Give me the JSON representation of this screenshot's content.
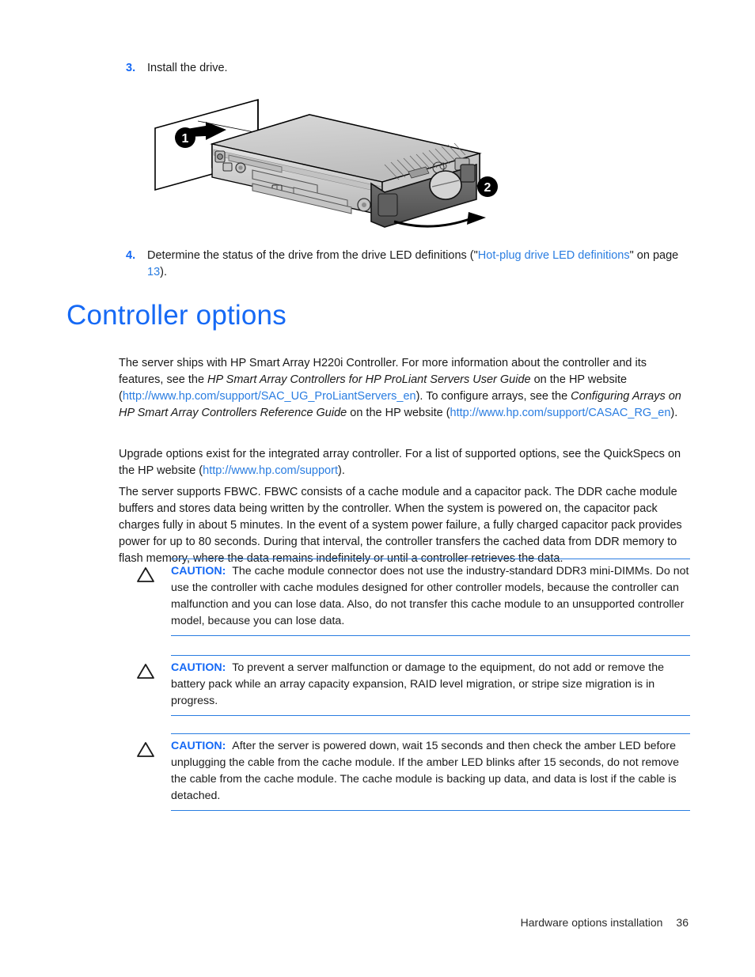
{
  "document": {
    "steps": [
      {
        "number": "3.",
        "text": "Install the drive."
      },
      {
        "number": "4.",
        "text_before": "Determine the status of the drive from the drive LED definitions (\"",
        "link_text": "Hot-plug drive LED definitions",
        "text_middle": "\" on page ",
        "page_link": "13",
        "text_after": ")."
      }
    ],
    "figure": {
      "name": "hot-plug-drive-installation-illustration",
      "callout_1": "1",
      "callout_2": "2"
    },
    "heading": "Controller options",
    "paragraphs": {
      "p1": {
        "s1": "The server ships with HP Smart Array H220i Controller. For more information about the controller and its features, see the ",
        "i1": "HP Smart Array Controllers for HP ProLiant Servers User Guide",
        "s2": " on the HP website (",
        "link1": "http://www.hp.com/support/SAC_UG_ProLiantServers_en",
        "s3": "). To configure arrays, see the ",
        "i2": "Configuring Arrays on HP Smart Array Controllers Reference Guide",
        "s4": " on the HP website (",
        "link2": "http://www.hp.com/support/CASAC_RG_en",
        "s5": ")."
      },
      "p2": {
        "s1": "Upgrade options exist for the integrated array controller. For a list of supported options, see the QuickSpecs on the HP website (",
        "link1": "http://www.hp.com/support",
        "s2": ")."
      },
      "p3": {
        "s1": "The server supports FBWC. FBWC consists of a cache module and a capacitor pack. The DDR cache module buffers and stores data being written by the controller. When the system is powered on, the capacitor pack charges fully in about 5 minutes. In the event of a system power failure, a fully charged capacitor pack provides power for up to 80 seconds. During that interval, the controller transfers the cached data from DDR memory to flash memory, where the data remains indefinitely or until a controller retrieves the data."
      }
    },
    "cautions": [
      {
        "label": "CAUTION:",
        "text": "The cache module connector does not use the industry-standard DDR3 mini-DIMMs. Do not use the controller with cache modules designed for other controller models, because the controller can malfunction and you can lose data. Also, do not transfer this cache module to an unsupported controller model, because you can lose data."
      },
      {
        "label": "CAUTION:",
        "text": "To prevent a server malfunction or damage to the equipment, do not add or remove the battery pack while an array capacity expansion, RAID level migration, or stripe size migration is in progress."
      },
      {
        "label": "CAUTION:",
        "text": "After the server is powered down, wait 15 seconds and then check the amber LED before unplugging the cable from the cache module. If the amber LED blinks after 15 seconds, do not remove the cable from the cache module. The cache module is backing up data, and data is lost if the cable is detached."
      }
    ],
    "footer": {
      "chapter": "Hardware options installation",
      "page_number": "36"
    },
    "colors": {
      "heading_blue": "#1569f5",
      "link_blue": "#2a7de1",
      "rule_blue": "#2a7de1",
      "body_text": "#1a1a1a"
    }
  }
}
